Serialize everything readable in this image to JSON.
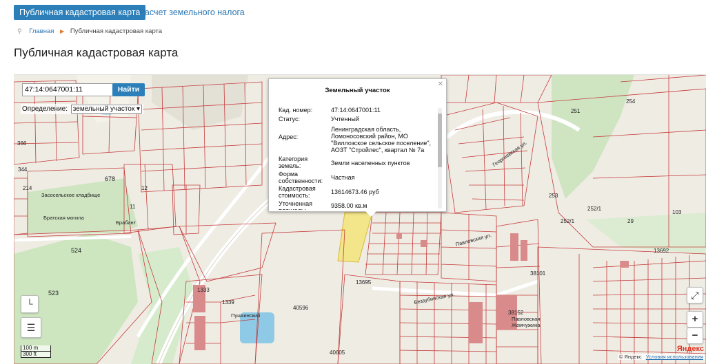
{
  "tabs": {
    "active": "Публичная кадастровая карта",
    "tax": "Расчет земельного налога"
  },
  "breadcrumb": {
    "home": "Главная",
    "current": "Публичная кадастровая карта"
  },
  "page_title": "Публичная кадастровая карта",
  "search": {
    "value": "47:14:0647001:11",
    "button": "Найти"
  },
  "definition": {
    "label": "Определение:",
    "selected": "земельный участок"
  },
  "popup": {
    "title": "Земельный участок",
    "rows": [
      {
        "key": "Кад. номер:",
        "value": "47:14:0647001:11"
      },
      {
        "key": "Статус:",
        "value": "Учтенный"
      },
      {
        "key": "Адрес:",
        "value": "Ленинградская область, Ломоносовский район, МО \"Виллозское сельское поселение\", АОЗТ \"Стройлес\", квартал № 7а"
      },
      {
        "key": "Категория земель:",
        "value": "Земли населенных пунктов"
      },
      {
        "key": "Форма собственности:",
        "value": "Частная"
      },
      {
        "key": "Кадастровая стоимость:",
        "value": "13614673.46 руб"
      },
      {
        "key": "Уточненная площадь:",
        "value": "9358.00 кв.м"
      }
    ]
  },
  "map_labels": {
    "cemetery": "Засосельское кладбище",
    "grave": "Братская могила",
    "brabant": "Брабант",
    "pushkinsky": "Пушкинский",
    "street1": "Павловская ул.",
    "street2": "Беззубинская ул.",
    "street3": "Георгиевская ул.",
    "village": "Павловская Жемчужина",
    "numbers": [
      "678",
      "524",
      "523",
      "1333",
      "1339",
      "40596",
      "40605",
      "13695",
      "38101",
      "38152",
      "253",
      "254",
      "251",
      "252/1",
      "252/1",
      "103",
      "29",
      "13692",
      "12",
      "11",
      "214",
      "344",
      "366",
      "390",
      "1336"
    ]
  },
  "controls": {
    "zoom_in": "+",
    "zoom_out": "−",
    "layers_icon": "layers-icon",
    "ruler_icon": "ruler-icon"
  },
  "scale": {
    "m": "100 m",
    "ft": "300 ft"
  },
  "attribution": {
    "brand": "Яндекс",
    "copyright": "© Яндекс",
    "terms": "Условия использования"
  }
}
